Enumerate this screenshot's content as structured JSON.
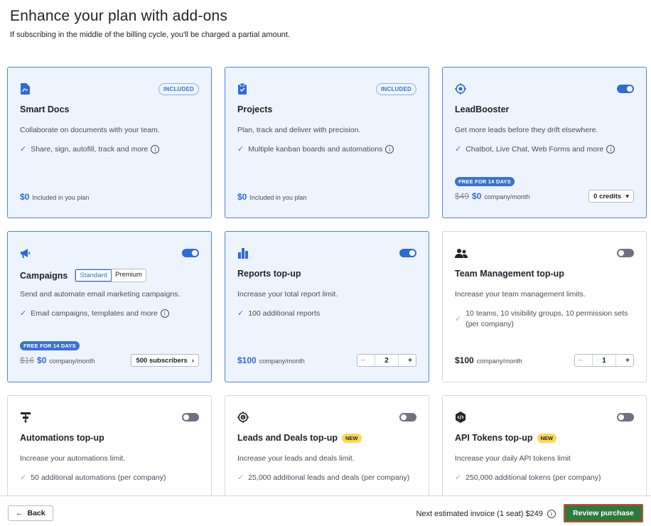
{
  "header": {
    "title": "Enhance your plan with add-ons",
    "subtitle": "If subscribing in the middle of the billing cycle, you'll be charged a partial amount."
  },
  "cards": [
    {
      "name": "Smart Docs",
      "icon": "smart-docs-icon",
      "badge": "INCLUDED",
      "desc": "Collaborate on documents with your team.",
      "feature": "Share, sign, autofill, track and more",
      "price": "$0",
      "price_unit": "Included in you plan"
    },
    {
      "name": "Projects",
      "icon": "projects-clipboard-icon",
      "badge": "INCLUDED",
      "desc": "Plan, track and deliver with precision.",
      "feature": "Multiple kanban boards and automations",
      "price": "$0",
      "price_unit": "Included in you plan"
    },
    {
      "name": "LeadBooster",
      "icon": "target-icon",
      "desc": "Get more leads before they drift elsewhere.",
      "feature": "Chatbot, Live Chat, Web Forms and more",
      "free_pill": "FREE FOR 14 DAYS",
      "old_price": "$49",
      "price": "$0",
      "price_unit": "company/month",
      "select": "0 credits"
    },
    {
      "name": "Campaigns",
      "icon": "megaphone-icon",
      "seg_on": "Standard",
      "seg_off": "Premium",
      "desc": "Send and automate email marketing campaigns.",
      "feature": "Email campaigns, templates and more",
      "free_pill": "FREE FOR 14 DAYS",
      "old_price": "$16",
      "price": "$0",
      "price_unit": "company/month",
      "select": "500 subscribers"
    },
    {
      "name": "Reports top-up",
      "icon": "bar-chart-icon",
      "desc": "Increase your total report limit.",
      "feature": "100 additional reports",
      "price": "$100",
      "price_unit": "company/month",
      "stepper": "2"
    },
    {
      "name": "Team Management top-up",
      "icon": "team-icon",
      "desc": "Increase your team management limits.",
      "feature": "10 teams, 10 visibility groups, 10 permission sets (per company)",
      "price": "$100",
      "price_unit": "company/month",
      "stepper": "1"
    },
    {
      "name": "Automations top-up",
      "icon": "automation-icon",
      "desc": "Increase your automations limit.",
      "feature": "50 additional automations (per company)"
    },
    {
      "name": "Leads and Deals top-up",
      "icon": "dollar-target-icon",
      "new_pill": "NEW",
      "desc": "Increase your leads and deals limit.",
      "feature": "25,000 additional leads and deals (per company)"
    },
    {
      "name": "API Tokens top-up",
      "icon": "api-code-icon",
      "new_pill": "NEW",
      "desc": "Increase your daily API tokens limit",
      "feature": "250,000 additional tokens (per company)"
    }
  ],
  "footer": {
    "back_label": "Back",
    "invoice_text": "Next estimated invoice (1 seat) $249",
    "review_label": "Review purchase"
  },
  "colors": {
    "accent": "#2f6bd5",
    "active_card_bg": "#eef4fd",
    "review_button": "#2c7a3e",
    "new_badge": "#ffd84d"
  }
}
